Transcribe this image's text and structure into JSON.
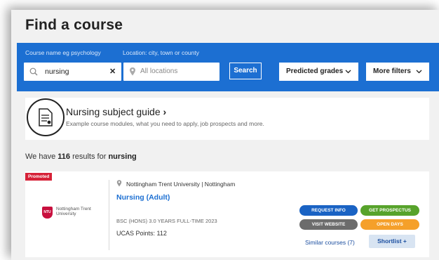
{
  "page": {
    "title": "Find a course"
  },
  "search": {
    "course_label": "Course name eg psychology",
    "location_label": "Location: city, town or county",
    "query": "nursing",
    "clear_symbol": "✕",
    "location_placeholder": "All locations",
    "search_button": "Search",
    "grades_dropdown": "Predicted grades",
    "filters_dropdown": "More filters"
  },
  "subject_guide": {
    "title": "Nursing subject guide",
    "arrow": "›",
    "description": "Example course modules, what you need to apply, job prospects and more."
  },
  "results": {
    "prefix": "We have ",
    "count": "116",
    "middle": " results for ",
    "term": "nursing"
  },
  "course_card": {
    "badge": "Promoted",
    "logo_text": "NTU",
    "logo_name": "Nottingham Trent University",
    "university": "Nottingham Trent University | Nottingham",
    "course_name": "Nursing (Adult)",
    "qualification": "BSC (HONS) 3.0 YEARS FULL-TIME 2023",
    "ucas_points": "UCAS Points: 112",
    "actions": {
      "request_info": "REQUEST INFO",
      "get_prospectus": "GET PROSPECTUS",
      "visit_website": "VISIT WEBSITE",
      "open_days": "OPEN DAYS"
    },
    "similar_courses": "Similar courses (7)",
    "shortlist": "Shortlist +"
  },
  "colors": {
    "brand_blue": "#1c6fd2",
    "request_blue": "#1a63c4",
    "prospectus_green": "#57a32b",
    "website_grey": "#6c6c6c",
    "opendays_orange": "#f5a02a",
    "promoted_red": "#d62137",
    "ntu_red": "#c8103e"
  },
  "icons": [
    "search-icon",
    "clear-icon",
    "location-pin-icon",
    "chevron-down-icon",
    "document-icon",
    "location-pin-icon"
  ]
}
